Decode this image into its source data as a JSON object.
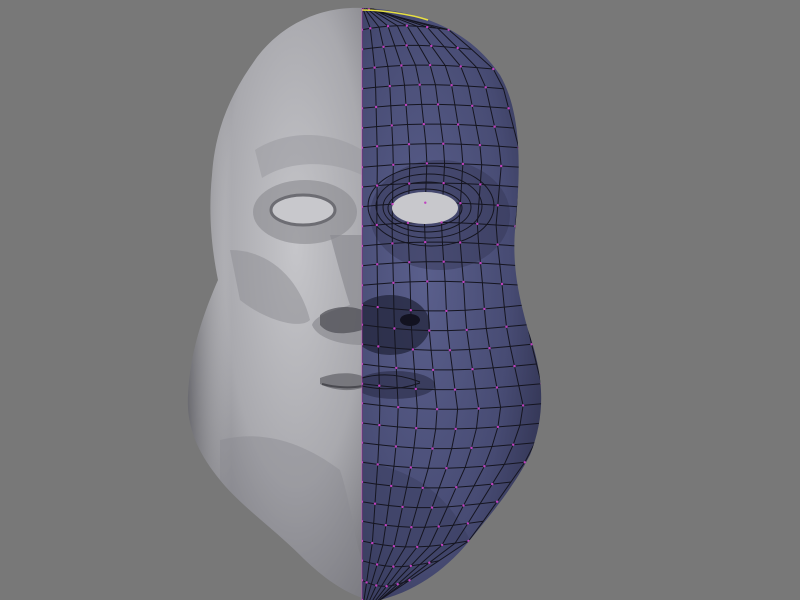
{
  "viewport": {
    "background_color": "#787878",
    "object": "face-mesh",
    "modes": {
      "left_half": "smooth-shaded",
      "right_half": "edit-mode-wireframe"
    },
    "colors": {
      "sculpt_light": "#b9b9bd",
      "sculpt_shadow": "#5a5a5e",
      "mesh_face": "#4c5078",
      "mesh_face_dark": "#2f3150",
      "mesh_edge": "#14141c",
      "vertex": "#c040c0",
      "selected_vertex": "#e8e040",
      "eye_socket": "#c8c8cc"
    }
  }
}
